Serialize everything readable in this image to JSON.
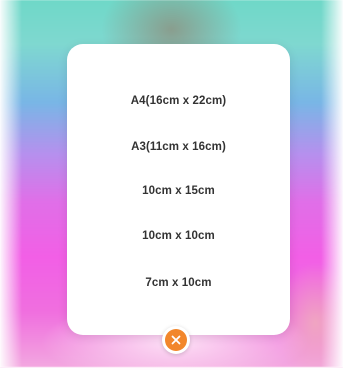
{
  "size_picker": {
    "options": [
      {
        "label": "A4(16cm x 22cm)"
      },
      {
        "label": "A3(11cm x 16cm)"
      },
      {
        "label": "10cm x 15cm"
      },
      {
        "label": "10cm x 10cm"
      },
      {
        "label": "7cm x 10cm"
      }
    ]
  },
  "close_button": {
    "icon": "close-icon",
    "color": "#f2862b"
  },
  "colors": {
    "sheet_background": "#ffffff",
    "option_text": "#333333",
    "accent": "#f2862b"
  }
}
